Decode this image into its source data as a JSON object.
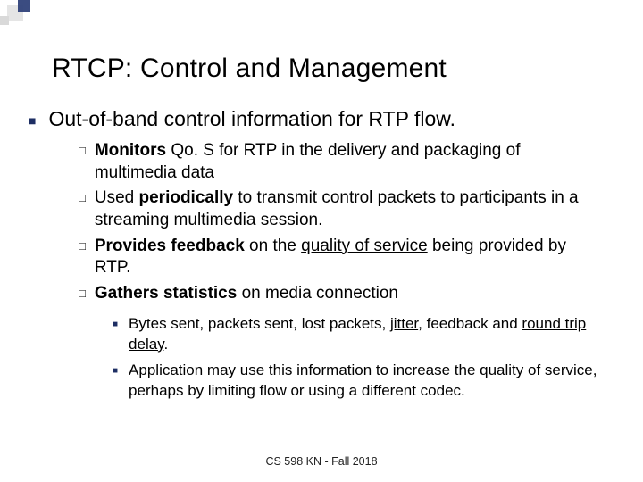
{
  "title": "RTCP: Control and Management",
  "main": {
    "bullet1": {
      "t1": "Out-of-band control information",
      "t2": " for  RTP flow."
    },
    "sub": [
      {
        "b1": "Monitors",
        "t1": " Qo. S for RTP in the delivery and packaging of multimedia data"
      },
      {
        "t0": "Used ",
        "b1": "periodically",
        "t1": " to transmit control packets to participants in a streaming multimedia session."
      },
      {
        "b1": "Provides feedback",
        "t1": " on the ",
        "u1": "quality of service",
        "t2": " being provided by RTP."
      },
      {
        "b1": "Gathers statistics",
        "t1": " on media connection"
      }
    ],
    "subsub": [
      {
        "t1": "Bytes sent, packets sent, lost packets, ",
        "u1": "jitter",
        "t2": ", feedback and ",
        "u2": "round trip delay",
        "t3": "."
      },
      {
        "t1": "Application may use this information to increase the quality of service, perhaps by limiting flow or using a different codec."
      }
    ]
  },
  "footer": "CS 598 KN - Fall 2018"
}
